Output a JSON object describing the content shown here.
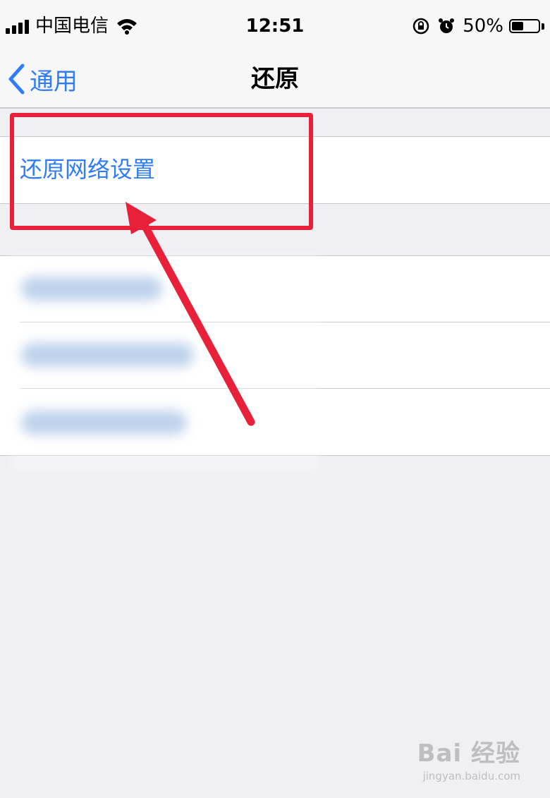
{
  "status_bar": {
    "carrier": "中国电信",
    "time": "12:51",
    "battery_percent": "50%",
    "battery_level": 0.5,
    "icons": [
      "signal-icon",
      "wifi-icon",
      "rotation-lock-icon",
      "alarm-icon",
      "battery-icon"
    ]
  },
  "nav": {
    "back_label": "通用",
    "title": "还原"
  },
  "settings": {
    "reset_network": "还原网络设置"
  },
  "watermark": {
    "logo": "Bai 经验",
    "url": "jingyan.baidu.com"
  },
  "colors": {
    "ios_blue": "#2f7cf6",
    "highlight_red": "#e8203a",
    "background": "#efeff4"
  }
}
